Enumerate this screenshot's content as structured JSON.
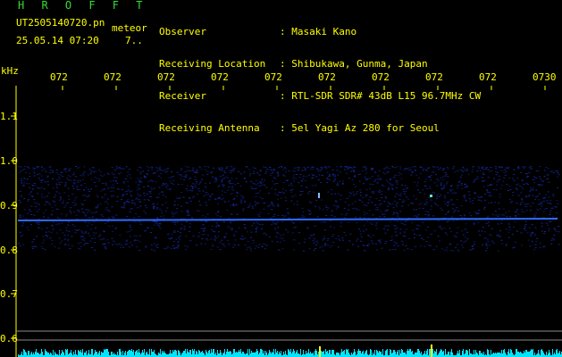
{
  "header": {
    "brand": "H R O F F T",
    "filename": "UT2505140720.pn",
    "mode": "meteor",
    "datetime": "25.05.14 07:20",
    "counter": "7..",
    "labels": [
      "Observer",
      "Receiving Location",
      "Receiver",
      "Receiving Antenna"
    ],
    "values": [
      ": Masaki Kano",
      ": Shibukawa, Gunma, Japan",
      ": RTL-SDR SDR# 43dB L15 96.7MHz CW",
      ": 5el Yagi Az 280 for Seoul"
    ]
  },
  "axis": {
    "unit": "kHz",
    "time_ticks": [
      "072",
      "072",
      "072",
      "072",
      "072",
      "072",
      "072",
      "072",
      "072",
      "0730"
    ],
    "freq_ticks": [
      "1.1",
      "1.0",
      "0.9",
      "0.8",
      "0.7",
      "0.6"
    ]
  },
  "colors": {
    "label": "#ffff00",
    "brand": "#33dd33",
    "signal": "#2f6cff",
    "meter": "#00e5ff"
  }
}
